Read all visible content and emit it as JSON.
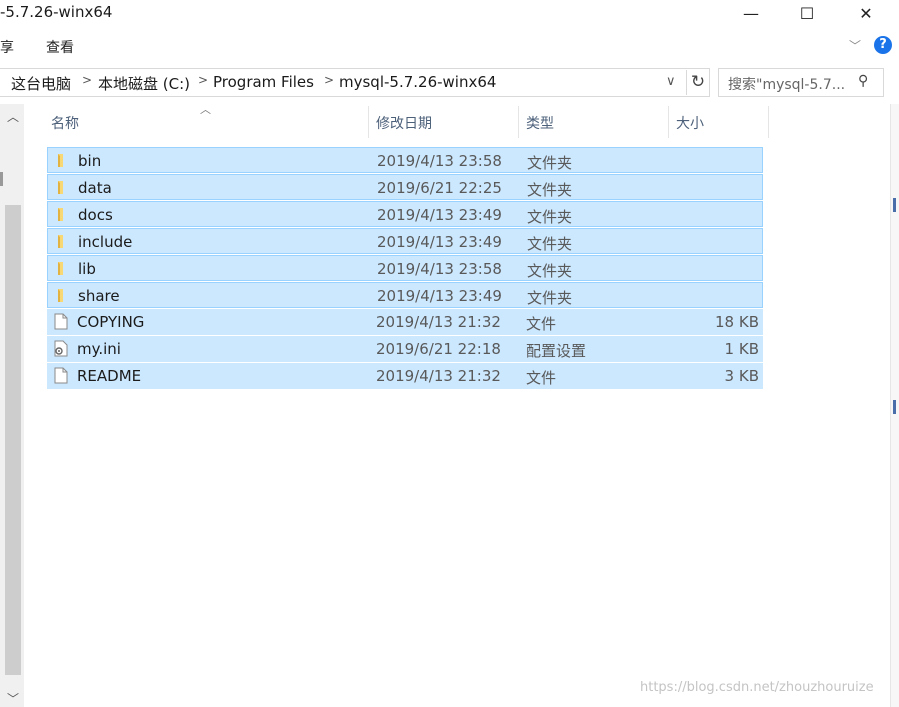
{
  "window": {
    "title": "-5.7.26-winx64",
    "minimize": "—",
    "maximize": "☐",
    "close": "✕"
  },
  "ribbon": {
    "tab_share": "享",
    "tab_view": "查看"
  },
  "address": {
    "crumbs": [
      "这台电脑",
      "本地磁盘 (C:)",
      "Program Files",
      "mysql-5.7.26-winx64"
    ],
    "search_placeholder": "搜索\"mysql-5.7..."
  },
  "columns": {
    "name": "名称",
    "date": "修改日期",
    "type": "类型",
    "size": "大小"
  },
  "files": [
    {
      "name": "bin",
      "date": "2019/4/13 23:58",
      "type": "文件夹",
      "size": "",
      "kind": "folder"
    },
    {
      "name": "data",
      "date": "2019/6/21 22:25",
      "type": "文件夹",
      "size": "",
      "kind": "folder"
    },
    {
      "name": "docs",
      "date": "2019/4/13 23:49",
      "type": "文件夹",
      "size": "",
      "kind": "folder"
    },
    {
      "name": "include",
      "date": "2019/4/13 23:49",
      "type": "文件夹",
      "size": "",
      "kind": "folder"
    },
    {
      "name": "lib",
      "date": "2019/4/13 23:58",
      "type": "文件夹",
      "size": "",
      "kind": "folder"
    },
    {
      "name": "share",
      "date": "2019/4/13 23:49",
      "type": "文件夹",
      "size": "",
      "kind": "folder"
    },
    {
      "name": "COPYING",
      "date": "2019/4/13 21:32",
      "type": "文件",
      "size": "18 KB",
      "kind": "file"
    },
    {
      "name": "my.ini",
      "date": "2019/6/21 22:18",
      "type": "配置设置",
      "size": "1 KB",
      "kind": "config"
    },
    {
      "name": "README",
      "date": "2019/4/13 21:32",
      "type": "文件",
      "size": "3 KB",
      "kind": "file"
    }
  ],
  "watermark": "https://blog.csdn.net/zhouzhouruize",
  "colors": {
    "selection": "#cce8ff",
    "selection_border": "#99d1ff",
    "folder": "#f8d775",
    "help": "#1a73e8"
  }
}
